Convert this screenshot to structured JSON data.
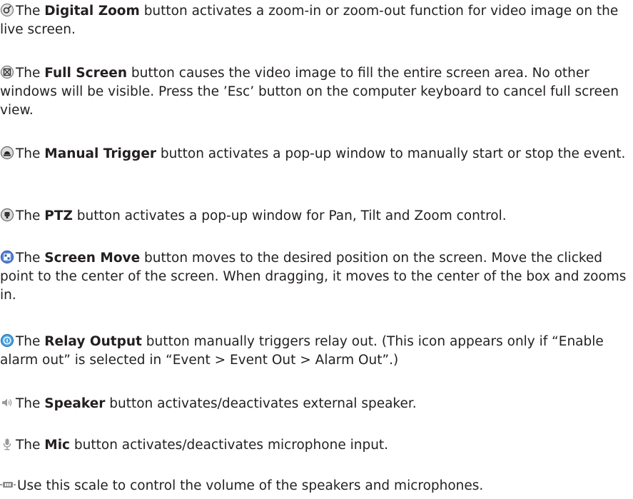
{
  "items": [
    {
      "icon": "digital-zoom-icon",
      "pre": "The ",
      "term": "Digital Zoom",
      "post": " button activates a zoom-in or zoom-out function for video image on the live screen."
    },
    {
      "icon": "full-screen-icon",
      "pre": "The ",
      "term": "Full Screen",
      "post": " button causes the video image to fill the entire screen area. No other windows will be visible. Press the ’Esc’ button on the computer keyboard to cancel full screen view."
    },
    {
      "icon": "manual-trigger-icon",
      "pre": "The ",
      "term": "Manual Trigger",
      "post": " button activates a pop-up window to manually start or stop the event."
    },
    {
      "icon": "ptz-icon",
      "pre": "The ",
      "term": "PTZ",
      "post": " button activates a pop-up window for Pan, Tilt and Zoom control."
    },
    {
      "icon": "screen-move-icon",
      "pre": "The ",
      "term": "Screen Move",
      "post": " button moves to the desired position on the screen. Move the clicked point to the center of the screen. When dragging, it moves to the center of the box and zooms in."
    },
    {
      "icon": "relay-output-icon",
      "pre": "The ",
      "term": "Relay Output",
      "post": " button manually triggers relay out.  (This icon appears only if “Enable alarm out” is selected in “Event > Event Out > Alarm Out”.)"
    },
    {
      "icon": "speaker-icon",
      "pre": "The ",
      "term": "Speaker",
      "post": " button activates/deactivates external speaker."
    },
    {
      "icon": "mic-icon",
      "pre": "The ",
      "term": "Mic",
      "post": " button activates/deactivates microphone input."
    },
    {
      "icon": "volume-scale-icon",
      "pre": "",
      "term": "",
      "post": "Use this scale to control the volume of the speakers and microphones."
    }
  ]
}
